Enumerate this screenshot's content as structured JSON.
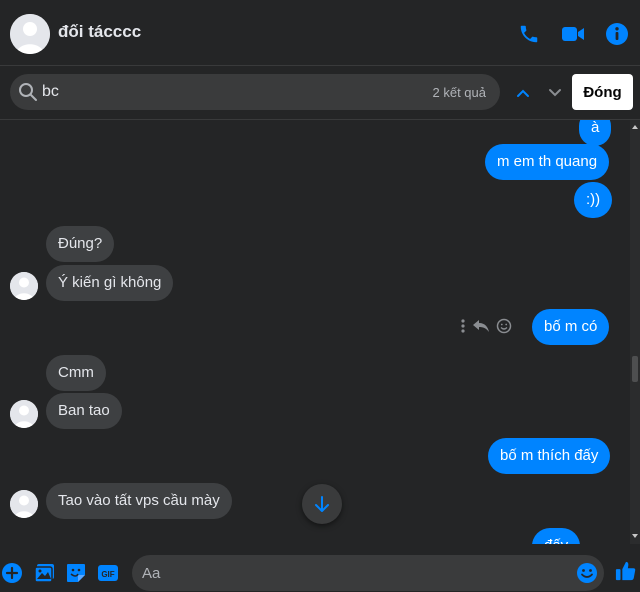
{
  "header": {
    "contact_name": "đối tácccc",
    "icons": [
      "phone-icon",
      "video-camera-icon",
      "info-icon"
    ]
  },
  "search": {
    "query": "bc",
    "result_count": "2 kết quả",
    "close_label": "Đóng"
  },
  "messages": [
    {
      "id": "m1",
      "direction": "out",
      "text": "à"
    },
    {
      "id": "m2",
      "direction": "out",
      "text": "m em th quang"
    },
    {
      "id": "m3",
      "direction": "out",
      "text": ":))"
    },
    {
      "id": "m4",
      "direction": "in",
      "text": "Đúng?"
    },
    {
      "id": "m5",
      "direction": "in",
      "text": "Ý kiến gì không"
    },
    {
      "id": "m6",
      "direction": "out",
      "text": "bố m có"
    },
    {
      "id": "m7",
      "direction": "in",
      "text": "Cmm"
    },
    {
      "id": "m8",
      "direction": "in",
      "text": "Ban tao"
    },
    {
      "id": "m9",
      "direction": "out",
      "text": "bố m thích đấy"
    },
    {
      "id": "m10",
      "direction": "in",
      "text": "Tao vào tất vps cầu mày"
    },
    {
      "id": "m11",
      "direction": "out",
      "text": "đấy"
    }
  ],
  "composer": {
    "placeholder": "Aa",
    "icons": [
      "plus-icon",
      "photo-icon",
      "sticker-icon",
      "gif-icon",
      "emoji-icon",
      "like-icon"
    ]
  },
  "colors": {
    "background": "#242526",
    "outgoing_bubble": "#0084ff",
    "incoming_bubble": "#3e4042",
    "accent": "#0084ff"
  }
}
